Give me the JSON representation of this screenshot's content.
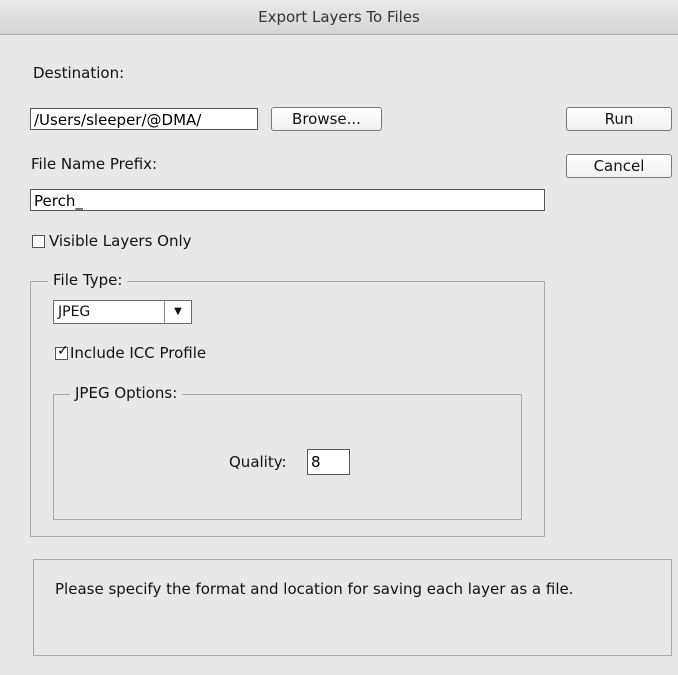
{
  "window": {
    "title": "Export Layers To Files"
  },
  "destination": {
    "label": "Destination:",
    "value": "/Users/sleeper/@DMA/",
    "browse_label": "Browse..."
  },
  "actions": {
    "run_label": "Run",
    "cancel_label": "Cancel"
  },
  "prefix": {
    "label": "File Name Prefix:",
    "value": "Perch_"
  },
  "visible_only": {
    "label": "Visible Layers Only",
    "checked": false
  },
  "file_type": {
    "legend": "File Type:",
    "selected": "JPEG",
    "icc": {
      "label": "Include ICC Profile",
      "checked": true
    }
  },
  "jpeg_options": {
    "legend": "JPEG Options:",
    "quality_label": "Quality:",
    "quality_value": "8"
  },
  "message": "Please specify the format and location for saving each layer as a file."
}
